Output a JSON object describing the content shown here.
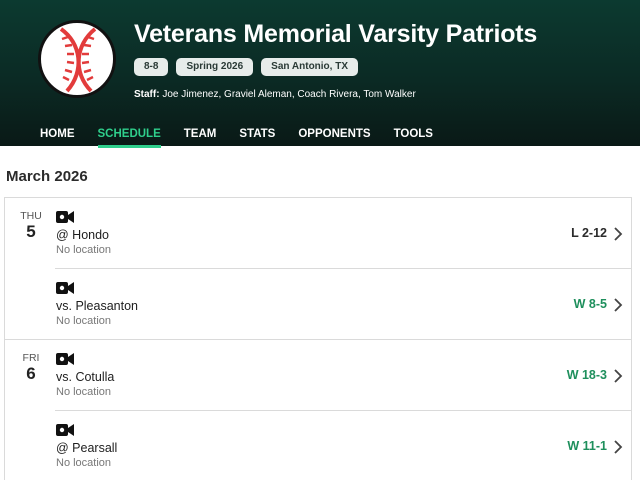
{
  "team": {
    "name": "Veterans Memorial Varsity Patriots",
    "record": "8-8",
    "season": "Spring 2026",
    "location": "San Antonio, TX",
    "staff_label": "Staff:",
    "staff": "Joe Jimenez, Graviel Aleman, Coach Rivera, Tom Walker",
    "logo_icon": "baseball-icon"
  },
  "nav": {
    "items": [
      {
        "label": "HOME"
      },
      {
        "label": "SCHEDULE"
      },
      {
        "label": "TEAM"
      },
      {
        "label": "STATS"
      },
      {
        "label": "OPPONENTS"
      },
      {
        "label": "TOOLS"
      }
    ],
    "active": "SCHEDULE"
  },
  "schedule": {
    "month": "March 2026",
    "days": [
      {
        "dow": "THU",
        "day": "5",
        "games": [
          {
            "opponent": "@ Hondo",
            "location": "No location",
            "result": "L 2-12",
            "outcome": "loss",
            "icon": "video-camera-icon"
          },
          {
            "opponent": "vs. Pleasanton",
            "location": "No location",
            "result": "W 8-5",
            "outcome": "win",
            "icon": "video-camera-icon"
          }
        ]
      },
      {
        "dow": "FRI",
        "day": "6",
        "games": [
          {
            "opponent": "vs. Cotulla",
            "location": "No location",
            "result": "W 18-3",
            "outcome": "win",
            "icon": "video-camera-icon"
          },
          {
            "opponent": "@ Pearsall",
            "location": "No location",
            "result": "W 11-1",
            "outcome": "win",
            "icon": "video-camera-icon"
          }
        ]
      }
    ]
  },
  "colors": {
    "header_bg": "#0b2a24",
    "accent_green": "#2fcf8c",
    "win_green": "#1e8f5c",
    "logo_red": "#e23b3b"
  }
}
